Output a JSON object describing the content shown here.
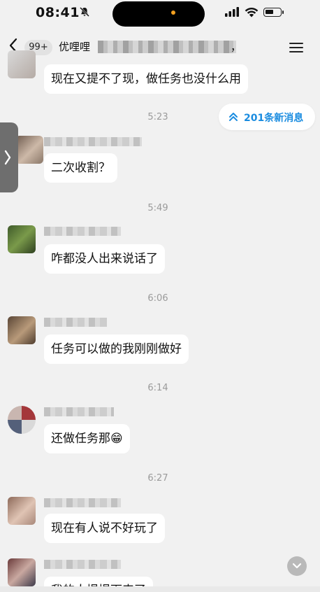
{
  "status_bar": {
    "time": "08:41"
  },
  "nav": {
    "unread_badge": "99+",
    "chat_title": "优哩哩",
    "title_tail": "，"
  },
  "new_messages_button": {
    "label": "201条新消息"
  },
  "messages": [
    {
      "text": "现在又提不了现，做任务也没什么用"
    },
    {
      "time": "5:23",
      "text": "二次收割？"
    },
    {
      "time": "5:49",
      "text": "咋都没人出来说话了"
    },
    {
      "time": "6:06",
      "text": "任务可以做的我刚刚做好"
    },
    {
      "time": "6:14",
      "text": "还做任务那😁"
    },
    {
      "time": "6:27",
      "text": "现在有人说不好玩了"
    },
    {
      "text": "我的人提提下来了"
    }
  ],
  "colors": {
    "background": "#f1f1f1",
    "bubble": "#ffffff",
    "accent_blue": "#1a8ce0",
    "timestamp_gray": "#9a9a9a"
  }
}
